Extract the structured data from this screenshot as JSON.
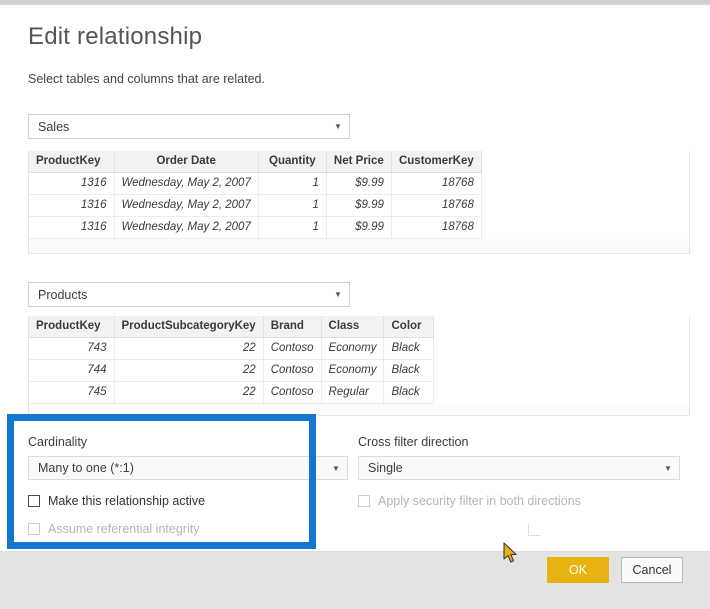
{
  "dialog": {
    "title": "Edit relationship",
    "subtitle": "Select tables and columns that are related.",
    "close_icon": "close-icon"
  },
  "sales_selector": {
    "value": "Sales",
    "caret_icon": "chevron-down-icon"
  },
  "products_selector": {
    "value": "Products",
    "caret_icon": "chevron-down-icon"
  },
  "sales_table": {
    "columns": [
      "ProductKey",
      "Order Date",
      "Quantity",
      "Net Price",
      "CustomerKey"
    ],
    "rows": [
      [
        "1316",
        "Wednesday, May 2, 2007",
        "1",
        "$9.99",
        "18768"
      ],
      [
        "1316",
        "Wednesday, May 2, 2007",
        "1",
        "$9.99",
        "18768"
      ],
      [
        "1316",
        "Wednesday, May 2, 2007",
        "1",
        "$9.99",
        "18768"
      ]
    ]
  },
  "products_table": {
    "columns": [
      "ProductKey",
      "ProductSubcategoryKey",
      "Brand",
      "Class",
      "Color"
    ],
    "rows": [
      [
        "743",
        "22",
        "Contoso",
        "Economy",
        "Black"
      ],
      [
        "744",
        "22",
        "Contoso",
        "Economy",
        "Black"
      ],
      [
        "745",
        "22",
        "Contoso",
        "Regular",
        "Black"
      ]
    ]
  },
  "cardinality": {
    "label": "Cardinality",
    "value": "Many to one (*:1)",
    "caret_icon": "chevron-down-icon",
    "active_checkbox_label": "Make this relationship active",
    "active_checked": false,
    "referential_checkbox_label": "Assume referential integrity",
    "referential_checked": false,
    "referential_disabled": true
  },
  "cross_filter": {
    "label": "Cross filter direction",
    "value": "Single",
    "caret_icon": "chevron-down-icon",
    "security_checkbox_label": "Apply security filter in both directions",
    "security_checked": false,
    "security_disabled": true
  },
  "footer": {
    "ok_label": "OK",
    "cancel_label": "Cancel"
  },
  "annotation": {
    "highlight_color": "#1277d0"
  }
}
